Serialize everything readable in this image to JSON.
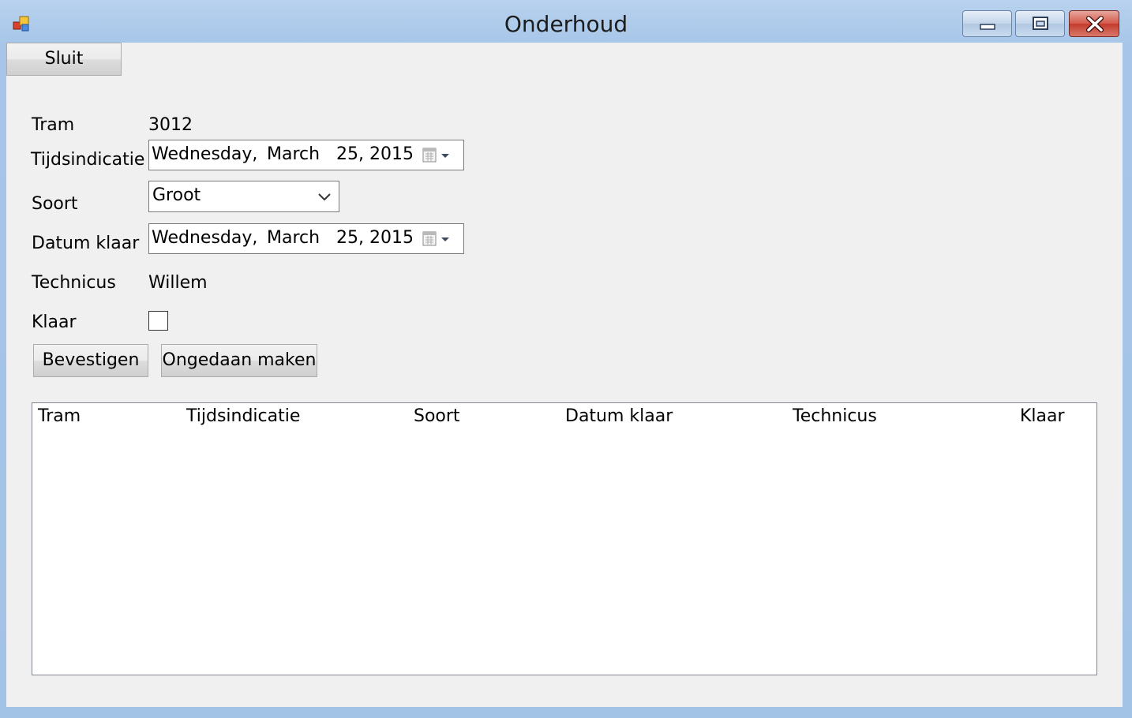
{
  "window": {
    "title": "Onderhoud",
    "icon": "app-form-icon",
    "controls": [
      "minimize-icon",
      "restore-icon",
      "close-icon"
    ]
  },
  "toolbar": {
    "close_label": "Sluit"
  },
  "form": {
    "tram_label": "Tram",
    "tram_value": "3012",
    "tijdsindicatie_label": "Tijdsindicatie",
    "tijdsindicatie": {
      "day": "Wednesday,",
      "month": "March",
      "date": "25, 2015"
    },
    "soort_label": "Soort",
    "soort_value": "Groot",
    "datum_klaar_label": "Datum klaar",
    "datum_klaar": {
      "day": "Wednesday,",
      "month": "March",
      "date": "25, 2015"
    },
    "technicus_label": "Technicus",
    "technicus_value": "Willem",
    "klaar_label": "Klaar",
    "klaar_checked": false
  },
  "actions": {
    "confirm_label": "Bevestigen",
    "undo_label": "Ongedaan maken"
  },
  "list": {
    "columns": [
      "Tram",
      "Tijdsindicatie",
      "Soort",
      "Datum klaar",
      "Technicus",
      "Klaar"
    ],
    "rows": []
  }
}
